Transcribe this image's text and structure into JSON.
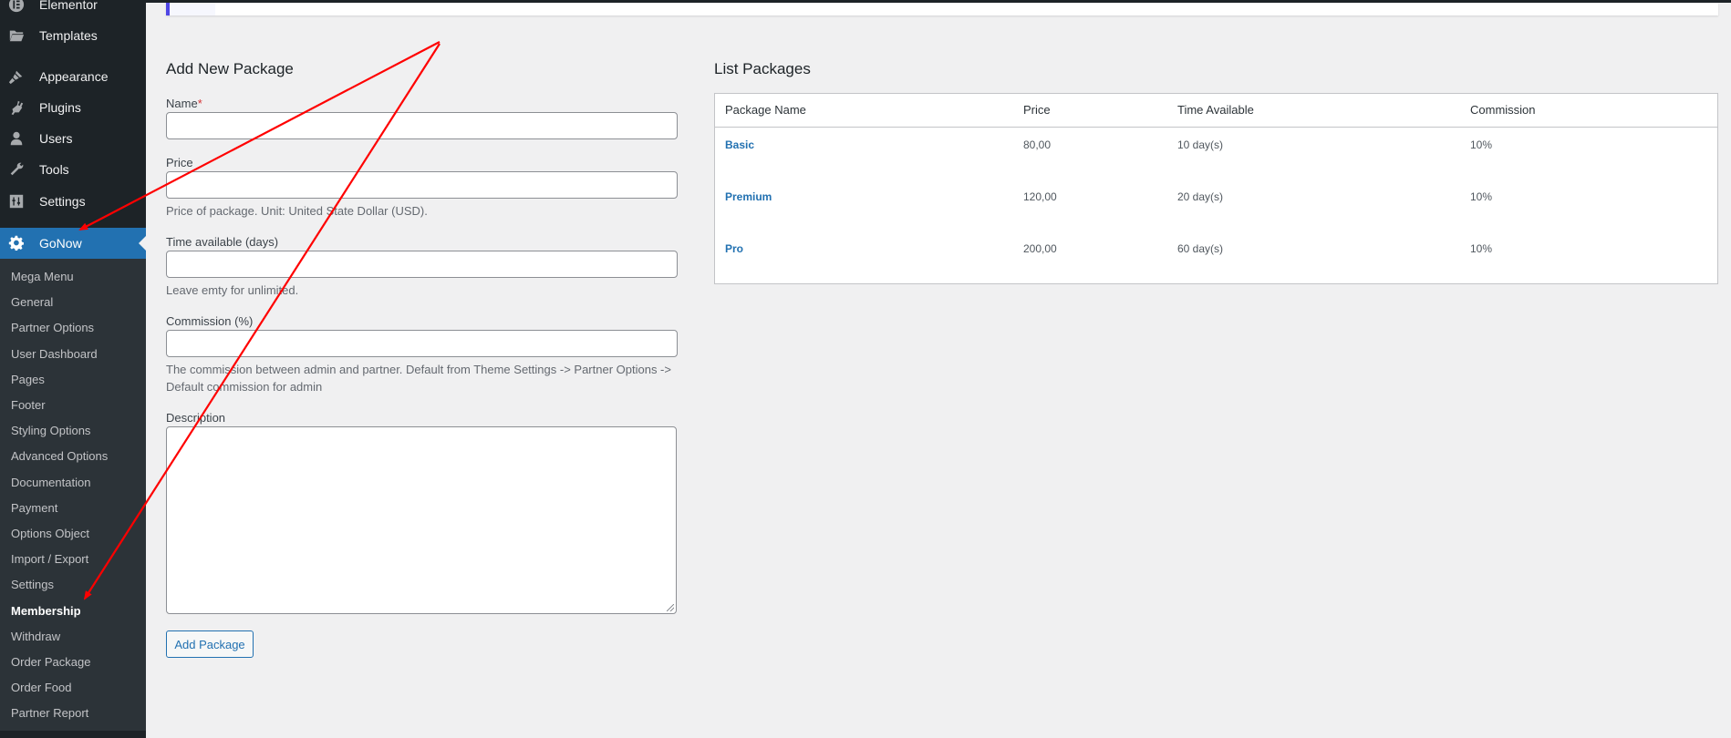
{
  "sidebar": {
    "menu": [
      {
        "label": "Elementor",
        "icon": "elementor-icon"
      },
      {
        "label": "Templates",
        "icon": "folder-icon"
      },
      {
        "label": "Appearance",
        "icon": "paintbrush-icon"
      },
      {
        "label": "Plugins",
        "icon": "plug-icon"
      },
      {
        "label": "Users",
        "icon": "user-icon"
      },
      {
        "label": "Tools",
        "icon": "wrench-icon"
      },
      {
        "label": "Settings",
        "icon": "sliders-icon"
      },
      {
        "label": "GoNow",
        "icon": "gear-icon"
      }
    ],
    "submenu": [
      "Mega Menu",
      "General",
      "Partner Options",
      "User Dashboard",
      "Pages",
      "Footer",
      "Styling Options",
      "Advanced Options",
      "Documentation",
      "Payment",
      "Options Object",
      "Import / Export",
      "Settings",
      "Membership",
      "Withdraw",
      "Order Package",
      "Order Food",
      "Partner Report"
    ],
    "active_submenu": "Membership",
    "current_menu": "GoNow"
  },
  "form": {
    "title": "Add New Package",
    "name_label": "Name",
    "name_required_mark": "*",
    "name_value": "",
    "price_label": "Price",
    "price_value": "",
    "price_help": "Price of package. Unit: United State Dollar (USD).",
    "time_label": "Time available (days)",
    "time_value": "",
    "time_help": "Leave emty for unlimited.",
    "commission_label": "Commission (%)",
    "commission_value": "",
    "commission_help_line1": "The commission between admin and partner. Default from Theme Settings -> Partner Options ->",
    "commission_help_line2": "Default commission for admin",
    "description_label": "Description",
    "description_value": "",
    "submit_label": "Add Package"
  },
  "list": {
    "title": "List Packages",
    "columns": [
      "Package Name",
      "Price",
      "Time Available",
      "Commission"
    ],
    "rows": [
      {
        "name": "Basic",
        "price": "80,00",
        "time": "10 day(s)",
        "commission": "10%"
      },
      {
        "name": "Premium",
        "price": "120,00",
        "time": "20 day(s)",
        "commission": "10%"
      },
      {
        "name": "Pro",
        "price": "200,00",
        "time": "60 day(s)",
        "commission": "10%"
      }
    ]
  },
  "colors": {
    "accent": "#2271b1",
    "sidebar_bg": "#1d2327",
    "submenu_bg": "#2c3338",
    "annotation_arrow": "#ff0000",
    "notice_border": "#4f46e5"
  }
}
